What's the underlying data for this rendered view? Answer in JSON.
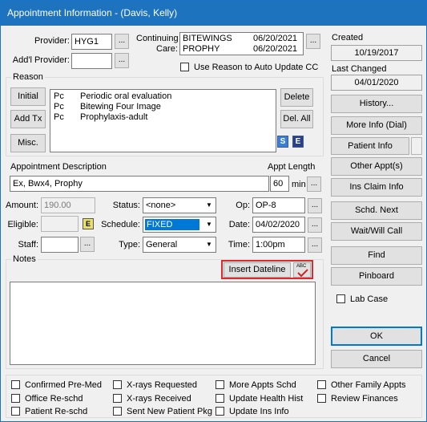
{
  "window": {
    "title": "Appointment Information - (Davis, Kelly)",
    "close_glyph": "✕"
  },
  "labels": {
    "provider": "Provider:",
    "addl_provider": "Add'l Provider:",
    "continuing_care_1": "Continuing",
    "continuing_care_2": "Care:",
    "use_reason": "Use Reason to Auto Update CC",
    "reason": "Reason",
    "appt_description": "Appointment Description",
    "appt_length": "Appt Length",
    "min": "min",
    "amount": "Amount:",
    "status": "Status:",
    "op": "Op:",
    "eligible": "Eligible:",
    "schedule": "Schedule:",
    "date": "Date:",
    "staff": "Staff:",
    "type": "Type:",
    "time": "Time:",
    "notes": "Notes",
    "created": "Created",
    "last_changed": "Last Changed",
    "lab_case": "Lab Case"
  },
  "values": {
    "provider": "HYG1",
    "addl_provider": "",
    "appt_description": "Ex, Bwx4, Prophy",
    "appt_length": "60",
    "amount": "190.00",
    "status": "<none>",
    "op": "OP-8",
    "eligible": "",
    "schedule": "FIXED",
    "date": "04/02/2020",
    "staff": "",
    "type": "General",
    "time": "1:00pm",
    "created": "10/19/2017",
    "last_changed": "04/01/2020",
    "notes": ""
  },
  "continuing_care": [
    {
      "name": "BITEWINGS",
      "date": "06/20/2021"
    },
    {
      "name": "PROPHY",
      "date": "06/20/2021"
    }
  ],
  "reason_items": [
    {
      "code": "Pc",
      "desc": "Periodic oral evaluation"
    },
    {
      "code": "Pc",
      "desc": "Bitewing Four Image"
    },
    {
      "code": "Pc",
      "desc": "Prophylaxis-adult"
    }
  ],
  "buttons": {
    "ellipsis": "...",
    "initial": "Initial",
    "add_tx": "Add Tx",
    "misc": "Misc.",
    "delete": "Delete",
    "del_all": "Del. All",
    "insert_dateline": "Insert Dateline",
    "history": "History...",
    "more_info": "More Info (Dial)",
    "patient_info": "Patient Info",
    "other_appts": "Other Appt(s)",
    "ins_claim_info": "Ins Claim Info",
    "schd_next": "Schd. Next",
    "wait_will_call": "Wait/Will Call",
    "find": "Find",
    "pinboard": "Pinboard",
    "ok": "OK",
    "cancel": "Cancel"
  },
  "icons": {
    "s_icon": "S",
    "e_icon": "E",
    "eligible_icon": "E",
    "spell_abc": "ABC",
    "dropdown_arrow": "▼"
  },
  "checkboxes": [
    {
      "label": "Confirmed Pre-Med"
    },
    {
      "label": "X-rays Requested"
    },
    {
      "label": "More Appts Schd"
    },
    {
      "label": "Other Family Appts"
    },
    {
      "label": "Office Re-schd"
    },
    {
      "label": "X-rays Received"
    },
    {
      "label": "Update Health Hist"
    },
    {
      "label": "Review Finances"
    },
    {
      "label": "Patient Re-schd"
    },
    {
      "label": "Sent New Patient Pkg"
    },
    {
      "label": "Update Ins Info"
    }
  ],
  "colors": {
    "title_bar": "#1e73be",
    "highlight": "#0078d7",
    "insert_dateline_outline": "#e0282c",
    "spell_check": "#d02020"
  }
}
